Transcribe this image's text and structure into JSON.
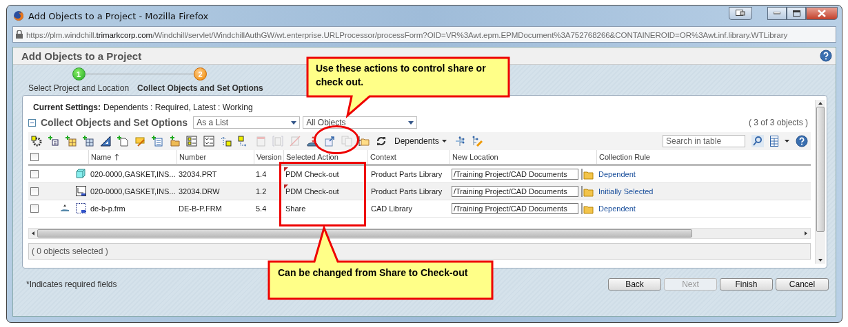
{
  "window": {
    "title": "Add Objects to a Project - Mozilla Firefox"
  },
  "url": {
    "host_start": "https://plm.windchill.",
    "domain": "trimarkcorp.com",
    "path": "/Windchill/servlet/WindchillAuthGW/wt.enterprise.URLProcessor/processForm?OID=VR%3Awt.epm.EPMDocument%3A752768266&CONTAINEROID=OR%3Awt.inf.library.WTLibrary"
  },
  "page": {
    "title": "Add Objects to a Project"
  },
  "steps": [
    {
      "number": "1",
      "label": "Select Project and Location",
      "selected": false
    },
    {
      "number": "2",
      "label": "Collect Objects and Set Options",
      "selected": true
    }
  ],
  "settings": {
    "label": "Current Settings:",
    "value": "Dependents : Required, Latest : Working"
  },
  "section": {
    "title": "Collect Objects and Set Options",
    "view_select": "As a List",
    "filter_select": "All Objects",
    "count": "( 3 of 3 objects )"
  },
  "toolbar": {
    "icons": [
      {
        "kind": "gear",
        "disabled": false
      },
      {
        "kind": "plus-tree",
        "disabled": false
      },
      {
        "kind": "plus-table",
        "disabled": false
      },
      {
        "kind": "plus-grid",
        "disabled": false
      },
      {
        "kind": "triangle",
        "disabled": false
      },
      {
        "kind": "plus-doc",
        "disabled": false
      },
      {
        "kind": "note",
        "disabled": false
      },
      {
        "kind": "plus-list",
        "disabled": false
      },
      {
        "kind": "plus-folder",
        "disabled": false
      },
      {
        "kind": "grid",
        "disabled": false
      },
      {
        "kind": "checklist",
        "disabled": false
      },
      {
        "kind": "dotted-arrow",
        "disabled": false
      },
      {
        "kind": "arrow-grid",
        "disabled": false
      },
      {
        "kind": "doc",
        "disabled": true
      },
      {
        "kind": "bracket-doc",
        "disabled": true
      },
      {
        "kind": "crossed-doc",
        "disabled": true
      },
      {
        "kind": "share",
        "disabled": false
      },
      {
        "kind": "arrow-doc",
        "disabled": false
      },
      {
        "kind": "copy",
        "disabled": true
      },
      {
        "kind": "folder",
        "disabled": false
      },
      {
        "kind": "refresh",
        "disabled": false
      }
    ],
    "menu": "Dependents",
    "after_icons": [
      {
        "kind": "tree",
        "disabled": false
      },
      {
        "kind": "tree-pencil",
        "disabled": false
      }
    ],
    "search": {
      "placeholder": "Search in table"
    }
  },
  "table": {
    "columns": [
      {
        "label": "Name",
        "sorted": true
      },
      {
        "label": "Number",
        "sorted": false
      },
      {
        "label": "Version",
        "sorted": false
      },
      {
        "label": "Selected Action",
        "sorted": false
      },
      {
        "label": "Context",
        "sorted": false
      },
      {
        "label": "New Location",
        "sorted": false
      },
      {
        "label": "Collection Rule",
        "sorted": false
      }
    ],
    "select_all": false,
    "rows": [
      {
        "checked": false,
        "shared": false,
        "kind": "part",
        "name": "020-0000,GASKET,INS...",
        "number": "32034.PRT",
        "version": "1.4",
        "action": "PDM Check-out",
        "modified": true,
        "context": "Product Parts Library",
        "location": "/Training Project/CAD Documents",
        "rule": "Dependent"
      },
      {
        "checked": false,
        "shared": false,
        "kind": "drawing",
        "name": "020-0000,GASKET,INS...",
        "number": "32034.DRW",
        "version": "1.2",
        "action": "PDM Check-out",
        "modified": true,
        "context": "Product Parts Library",
        "location": "/Training Project/CAD Documents",
        "rule": "Initially Selected"
      },
      {
        "checked": false,
        "shared": true,
        "kind": "format",
        "name": "de-b-p.frm",
        "number": "DE-B-P.FRM",
        "version": "5.4",
        "action": "Share",
        "modified": false,
        "context": "CAD Library",
        "location": "/Training Project/CAD Documents",
        "rule": "Dependent"
      }
    ]
  },
  "status": "( 0 objects selected )",
  "footer": {
    "note": "*Indicates required fields",
    "buttons": [
      {
        "label": "Back",
        "disabled": false
      },
      {
        "label": "Next",
        "disabled": true
      },
      {
        "label": "Finish",
        "disabled": false
      },
      {
        "label": "Cancel",
        "disabled": false
      }
    ]
  },
  "callouts": [
    {
      "text": "Use these actions to control share or check out."
    },
    {
      "text": "Can be changed from Share to Check-out"
    }
  ]
}
